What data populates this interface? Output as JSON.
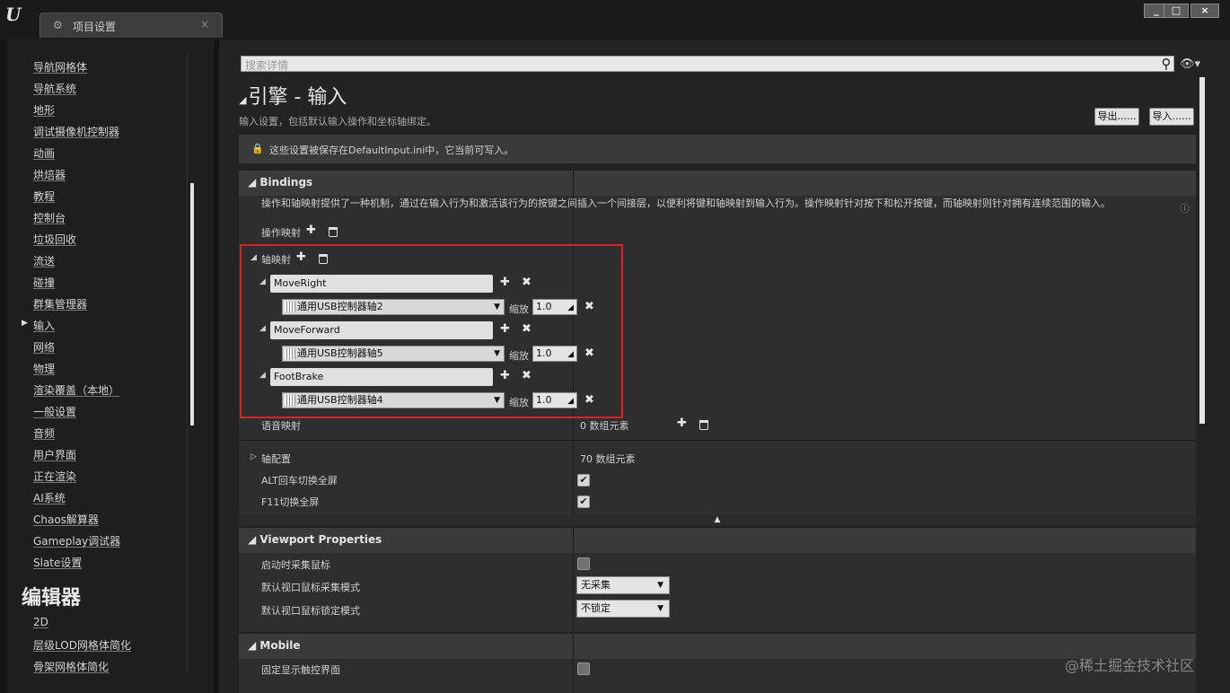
{
  "window": {
    "tab_label": "项目设置",
    "minimize": "_",
    "maximize": "□",
    "close": "×"
  },
  "sidebar": {
    "items": [
      "导航网格体",
      "导航系统",
      "地形",
      "调试摄像机控制器",
      "动画",
      "烘焙器",
      "教程",
      "控制台",
      "垃圾回收",
      "流送",
      "碰撞",
      "群集管理器",
      "输入",
      "网络",
      "物理",
      "渲染覆盖（本地）",
      "一般设置",
      "音频",
      "用户界面",
      "正在渲染",
      "AI系统",
      "Chaos解算器",
      "Gameplay调试器",
      "Slate设置"
    ],
    "selected_index": 12,
    "section_title": "编辑器",
    "editor_items": [
      "2D",
      "层级LOD网格体简化",
      "骨架网格体简化"
    ]
  },
  "search": {
    "placeholder": "搜索详情"
  },
  "page": {
    "title": "引擎 - 输入",
    "description": "输入设置，包括默认输入操作和坐标轴绑定。",
    "export_label": "导出......",
    "import_label": "导入......",
    "notice": "这些设置被保存在DefaultInput.ini中，它当前可写入。"
  },
  "bindings": {
    "header": "Bindings",
    "description": "操作和轴映射提供了一种机制，通过在输入行为和激活该行为的按键之间插入一个间接层，以便利将键和轴映射到输入行为。操作映射针对按下和松开按键，而轴映射则针对拥有连续范围的输入。",
    "action_mappings_label": "操作映射",
    "axis_mappings_label": "轴映射",
    "axis_mappings": [
      {
        "name": "MoveRight",
        "key": "通用USB控制器轴2",
        "scale_label": "缩放",
        "scale": "1.0"
      },
      {
        "name": "MoveForward",
        "key": "通用USB控制器轴5",
        "scale_label": "缩放",
        "scale": "1.0"
      },
      {
        "name": "FootBrake",
        "key": "通用USB控制器轴4",
        "scale_label": "缩放",
        "scale": "1.0"
      }
    ],
    "speech_mappings_label": "语音映射",
    "speech_mappings_count": "0 数组元素",
    "axis_config_label": "轴配置",
    "axis_config_count": "70 数组元素",
    "alt_enter_label": "ALT回车切换全屏",
    "alt_enter_checked": true,
    "f11_label": "F11切换全屏",
    "f11_checked": true
  },
  "viewport": {
    "header": "Viewport Properties",
    "capture_on_start_label": "启动时采集鼠标",
    "capture_on_start_checked": false,
    "capture_mode_label": "默认视口鼠标采集模式",
    "capture_mode_value": "无采集",
    "lock_mode_label": "默认视口鼠标锁定模式",
    "lock_mode_value": "不锁定"
  },
  "mobile": {
    "header": "Mobile",
    "always_show_touch_label": "固定显示触控界面"
  },
  "watermark": "@稀土掘金技术社区"
}
